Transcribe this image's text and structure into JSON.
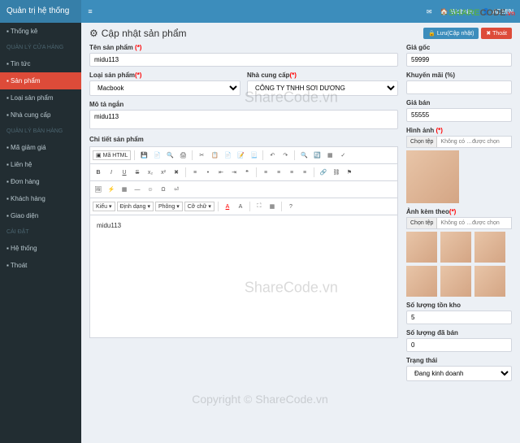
{
  "brand": "Quản trị hệ thống",
  "top": {
    "website": "Website",
    "admin": "ADMIN"
  },
  "sidebar": {
    "items": [
      {
        "type": "item",
        "label": "Thống kê"
      },
      {
        "type": "header",
        "label": "QUẢN LÝ CỬA HÀNG"
      },
      {
        "type": "item",
        "label": "Tin tức"
      },
      {
        "type": "item",
        "label": "Sản phẩm",
        "active": true
      },
      {
        "type": "item",
        "label": "Loại sản phẩm"
      },
      {
        "type": "item",
        "label": "Nhà cung cấp"
      },
      {
        "type": "header",
        "label": "QUẢN LÝ BÁN HÀNG"
      },
      {
        "type": "item",
        "label": "Mã giảm giá"
      },
      {
        "type": "item",
        "label": "Liên hệ"
      },
      {
        "type": "item",
        "label": "Đơn hàng"
      },
      {
        "type": "item",
        "label": "Khách hàng"
      },
      {
        "type": "item",
        "label": "Giao diện"
      },
      {
        "type": "header",
        "label": "CÀI ĐẶT"
      },
      {
        "type": "item",
        "label": "Hệ thống"
      },
      {
        "type": "item",
        "label": "Thoát"
      }
    ]
  },
  "page": {
    "title": "Cập nhật sản phẩm",
    "save": "Lưu(Cập nhật)",
    "exit": "Thoát"
  },
  "form": {
    "name_label": "Tên sản phẩm",
    "name_value": "midu113",
    "type_label": "Loại sản phẩm",
    "type_value": "Macbook",
    "supplier_label": "Nhà cung cấp",
    "supplier_value": "CÔNG TY TNHH SƠI DƯƠNG",
    "short_label": "Mô tả ngắn",
    "short_value": "midu113",
    "detail_label": "Chi tiết sản phẩm",
    "detail_value": "midu113",
    "src_btn": "Mã HTML",
    "style": "Kiểu",
    "format": "Định dạng",
    "font": "Phông",
    "size": "Cỡ chữ"
  },
  "right": {
    "price_orig_label": "Giá gốc",
    "price_orig": "59999",
    "promo_label": "Khuyến mãi (%)",
    "promo": "",
    "price_sale_label": "Giá bán",
    "price_sale": "55555",
    "image_label": "Hình ảnh",
    "images_label": "Ảnh kèm theo",
    "file_btn": "Chọn tệp",
    "file_txt": "Không có …được chọn",
    "stock_label": "Số lượng tồn kho",
    "stock": "5",
    "sold_label": "Số lượng đã bán",
    "sold": "0",
    "status_label": "Trạng thái",
    "status": "Đang kinh doanh"
  },
  "wm": {
    "a": "ShareCode.vn",
    "c": "Copyright © ShareCode.vn"
  },
  "logo": {
    "a": "SHARE",
    "b": "CODE",
    "c": ".vn"
  }
}
